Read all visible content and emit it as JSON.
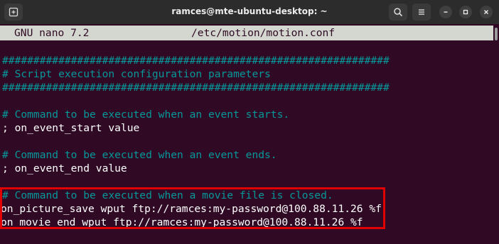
{
  "window": {
    "title": "ramces@mte-ubuntu-desktop: ~",
    "icons": [
      "new-tab-icon",
      "search-icon",
      "menu-icon",
      "minimize-icon",
      "maximize-icon",
      "close-icon"
    ]
  },
  "nano": {
    "version": "GNU nano 7.2",
    "filename": "/etc/motion/motion.conf"
  },
  "lines": [
    {
      "text": "##############################################################",
      "type": "comment"
    },
    {
      "text": "# Script execution configuration parameters",
      "type": "comment"
    },
    {
      "text": "##############################################################",
      "type": "comment"
    },
    {
      "text": "",
      "type": "blank"
    },
    {
      "text": "# Command to be executed when an event starts.",
      "type": "comment"
    },
    {
      "text": "; on_event_start value",
      "type": "text"
    },
    {
      "text": "",
      "type": "blank"
    },
    {
      "text": "# Command to be executed when an event ends.",
      "type": "comment"
    },
    {
      "text": "; on_event_end value",
      "type": "text"
    },
    {
      "text": "",
      "type": "blank"
    },
    {
      "text": "# Command to be executed when a movie file is closed.",
      "type": "comment"
    },
    {
      "text": "on_picture_save wput ftp://ramces:my-password@100.88.11.26 %f",
      "type": "text"
    },
    {
      "text": "on_movie_end wput ftp://ramces:my-password@100.88.11.26 %f",
      "type": "text"
    }
  ],
  "colors": {
    "terminal_bg": "#300a24",
    "comment": "#06989a",
    "text": "#ffffff",
    "header_bg": "#d3d7cf",
    "highlight": "#e00000"
  }
}
